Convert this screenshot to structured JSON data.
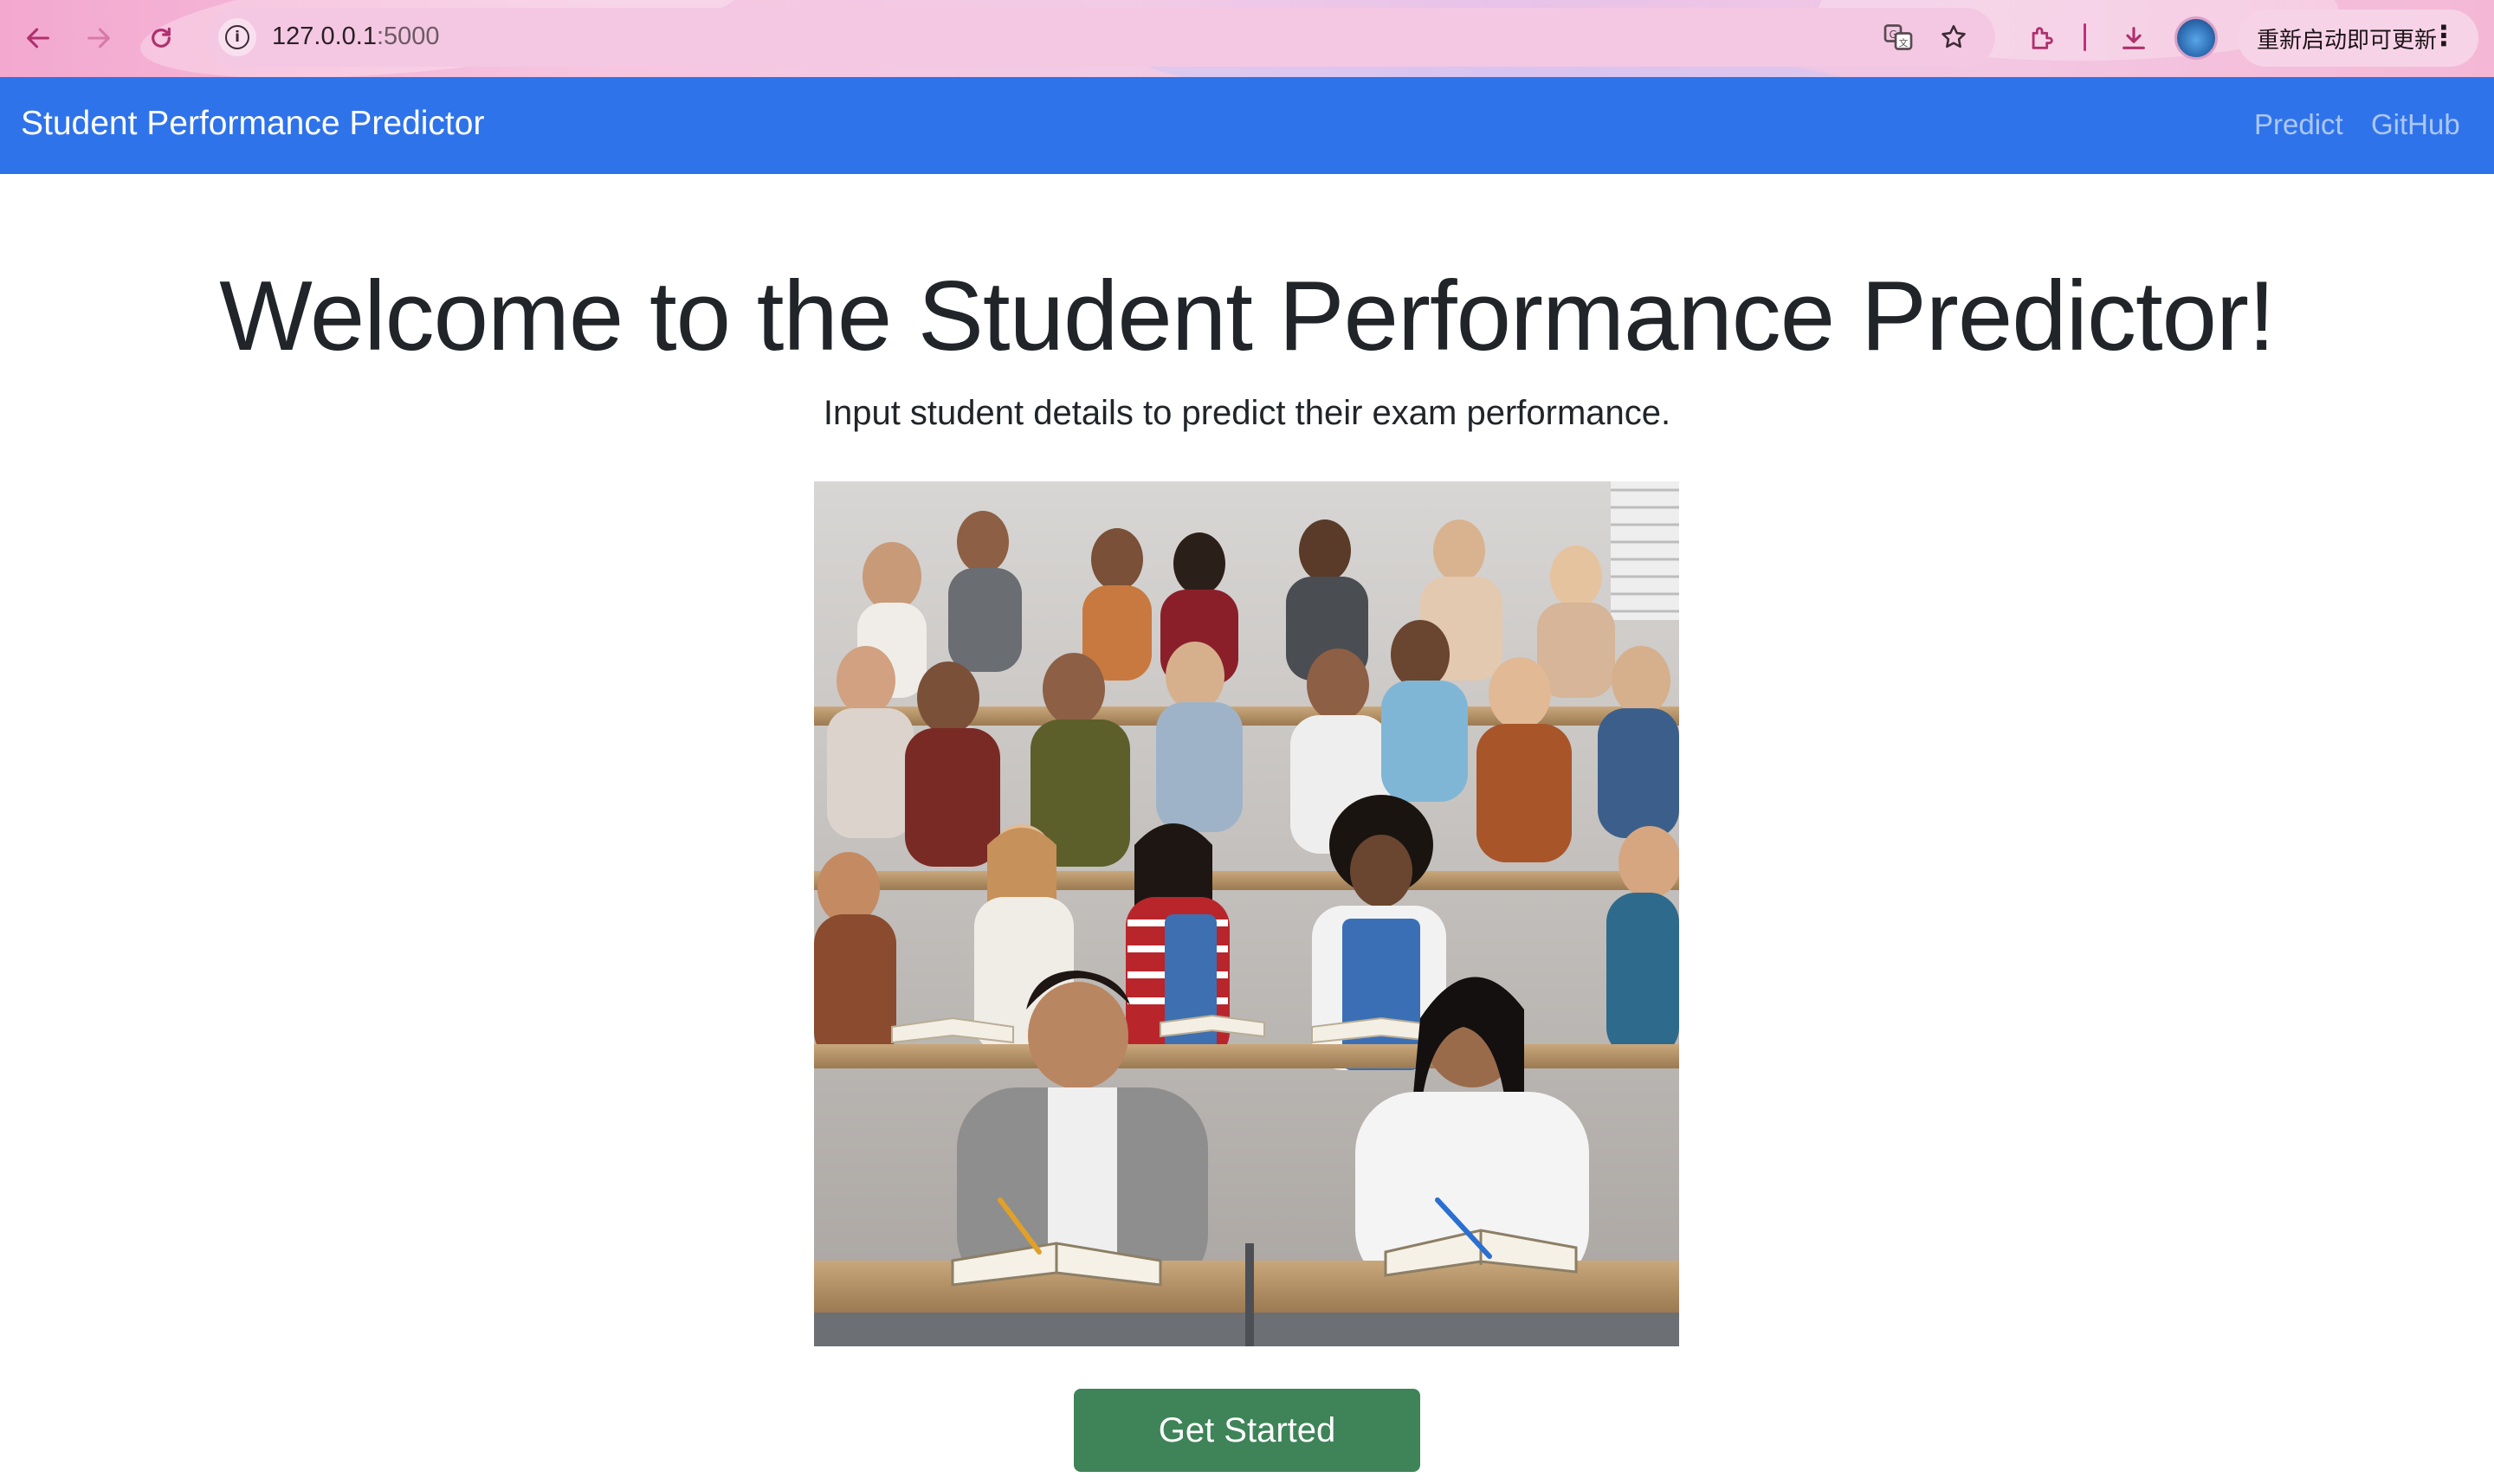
{
  "browser": {
    "url_host": "127.0.0.1",
    "url_port": ":5000",
    "update_button_label": "重新启动即可更新",
    "icons": [
      "back-arrow-icon",
      "forward-arrow-icon",
      "reload-icon",
      "site-info-icon",
      "translate-icon",
      "bookmark-star-icon",
      "extensions-icon",
      "download-icon",
      "profile-avatar",
      "more-menu-icon"
    ]
  },
  "navbar": {
    "brand": "Student Performance Predictor",
    "links": [
      {
        "label": "Predict"
      },
      {
        "label": "GitHub"
      }
    ],
    "color": "#2f73ea"
  },
  "hero": {
    "title": "Welcome to the Student Performance Predictor!",
    "subtitle": "Input student details to predict their exam performance.",
    "image_description": "classroom-students-studying",
    "cta_label": "Get Started",
    "cta_color": "#3e8458"
  }
}
